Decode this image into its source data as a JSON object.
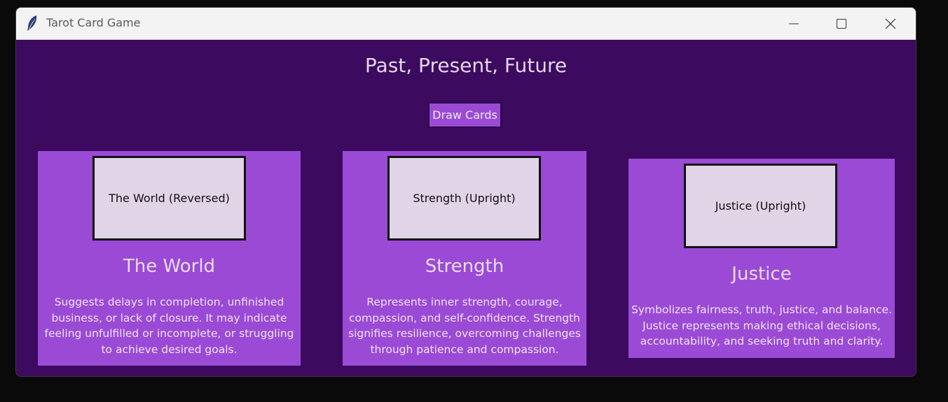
{
  "window": {
    "title": "Tarot Card Game",
    "app_icon": "feather-icon",
    "controls": [
      "minimize-icon",
      "maximize-icon",
      "close-icon"
    ]
  },
  "main": {
    "heading": "Past, Present, Future",
    "draw_button_label": "Draw Cards"
  },
  "cards": [
    {
      "face_label": "The World (Reversed)",
      "name": "The World",
      "description_lines": [
        "Suggests delays in completion, unfinished",
        "business, or lack of closure. It may indicate",
        "feeling unfulfilled or incomplete, or struggling",
        "to achieve desired goals."
      ]
    },
    {
      "face_label": "Strength (Upright)",
      "name": "Strength",
      "description_lines": [
        "Represents inner strength, courage,",
        "compassion, and self-confidence. Strength",
        "signifies resilience, overcoming challenges",
        "through patience and compassion."
      ]
    },
    {
      "face_label": "Justice (Upright)",
      "name": "Justice",
      "description_lines": [
        "Symbolizes fairness, truth, justice, and balance.",
        "Justice represents making ethical decisions,",
        "accountability, and seeking truth and clarity."
      ]
    }
  ],
  "colors": {
    "background": "#3c0a5f",
    "panel": "#9b4ad6",
    "card_face": "#e1d4e6",
    "text_light": "#e8dcef"
  }
}
